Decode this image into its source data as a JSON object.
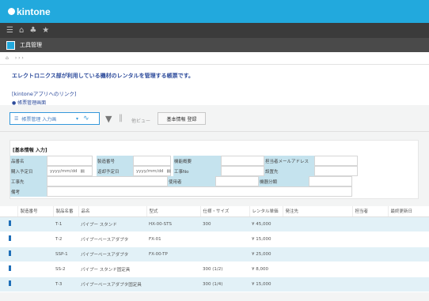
{
  "brand": {
    "name": "kintone"
  },
  "app": {
    "name": "工具管理"
  },
  "description": {
    "text": "エレクトロニクス部が利用している機材のレンタルを管理する帳票です。",
    "link_text": "[kintoneアプリへのリンク]",
    "sub_text": "● 帳票管理画面"
  },
  "toolbar": {
    "view_label": "帳票管理 入力画",
    "more_label": "他ビュー",
    "toggle_label": "基本情報 登録"
  },
  "form": {
    "title": "[基本情報 入力]",
    "date_placeholder": "yyyy/mm/dd",
    "rows": [
      [
        {
          "label": "品番名"
        },
        {
          "label": "製造番号"
        },
        {
          "label": "機能概要"
        },
        {
          "label": "担当者メールアドレス"
        }
      ],
      [
        {
          "label": "購入予定日",
          "value": "yyyy/mm/dd"
        },
        {
          "label": "返却予定日",
          "value": "yyyy/mm/dd"
        },
        {
          "label": "工事No"
        },
        {
          "label": "設置先"
        }
      ],
      [
        {
          "label": "工事先"
        },
        {
          "label": "使用者"
        },
        {
          "label": "機器分類"
        }
      ],
      [
        {
          "label": "備考"
        }
      ]
    ]
  },
  "table": {
    "columns": [
      "",
      "製造番号",
      "製品名番",
      "品名",
      "型式",
      "仕様・サイズ",
      "レンタル単価",
      "発注先",
      "担当者",
      "最終更新日"
    ],
    "rows": [
      [
        "",
        "",
        "T-1",
        "パイプー スタンド",
        "HX-00-STS",
        "300",
        "¥ 45,000",
        "",
        "",
        ""
      ],
      [
        "",
        "",
        "T-2",
        "パイプーベースアダプタ",
        "FX-01",
        "",
        "¥ 15,000",
        "",
        "",
        ""
      ],
      [
        "",
        "",
        "SSP-1",
        "パイプーベースアダプタ",
        "FX-00-TP",
        "",
        "¥ 25,000",
        "",
        "",
        ""
      ],
      [
        "",
        "",
        "SS-2",
        "パイプー スタンド固定具",
        "",
        "300 (1/2)",
        "¥ 8,000",
        "",
        "",
        ""
      ],
      [
        "",
        "",
        "T-3",
        "パイプーベースアダプタ固定具",
        "",
        "300 (1/4)",
        "¥ 15,000",
        "",
        "",
        ""
      ]
    ]
  }
}
